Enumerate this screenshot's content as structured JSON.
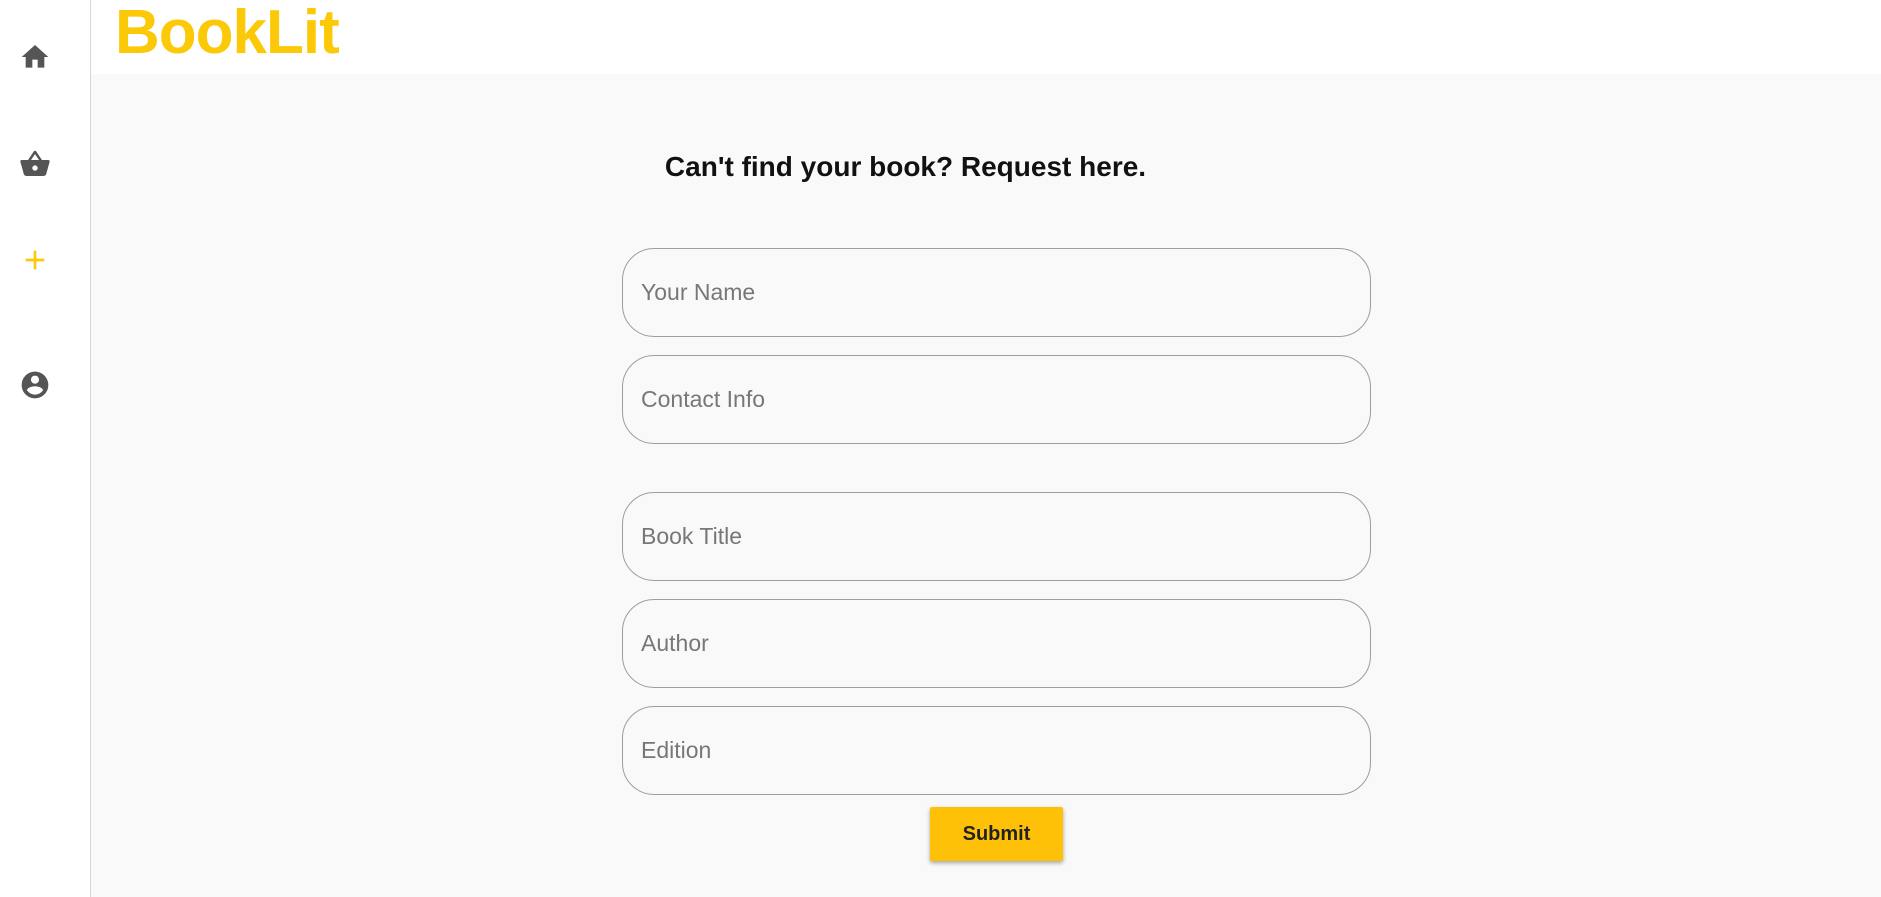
{
  "app": {
    "logo": "BookLit"
  },
  "colors": {
    "brand": "#fcc908",
    "icon_default": "#555555",
    "icon_active": "#fcc908",
    "submit_bg": "#ffc107"
  },
  "sidebar": {
    "items": [
      {
        "icon": "home-icon",
        "active": false
      },
      {
        "icon": "basket-icon",
        "active": false
      },
      {
        "icon": "plus-icon",
        "active": true
      },
      {
        "icon": "account-icon",
        "active": false
      }
    ]
  },
  "form": {
    "title": "Can't find your book? Request here.",
    "fields": [
      {
        "placeholder": "Your Name",
        "value": ""
      },
      {
        "placeholder": "Contact Info",
        "value": ""
      },
      {
        "placeholder": "Book Title",
        "value": ""
      },
      {
        "placeholder": "Author",
        "value": ""
      },
      {
        "placeholder": "Edition",
        "value": ""
      }
    ],
    "submit_label": "Submit"
  }
}
